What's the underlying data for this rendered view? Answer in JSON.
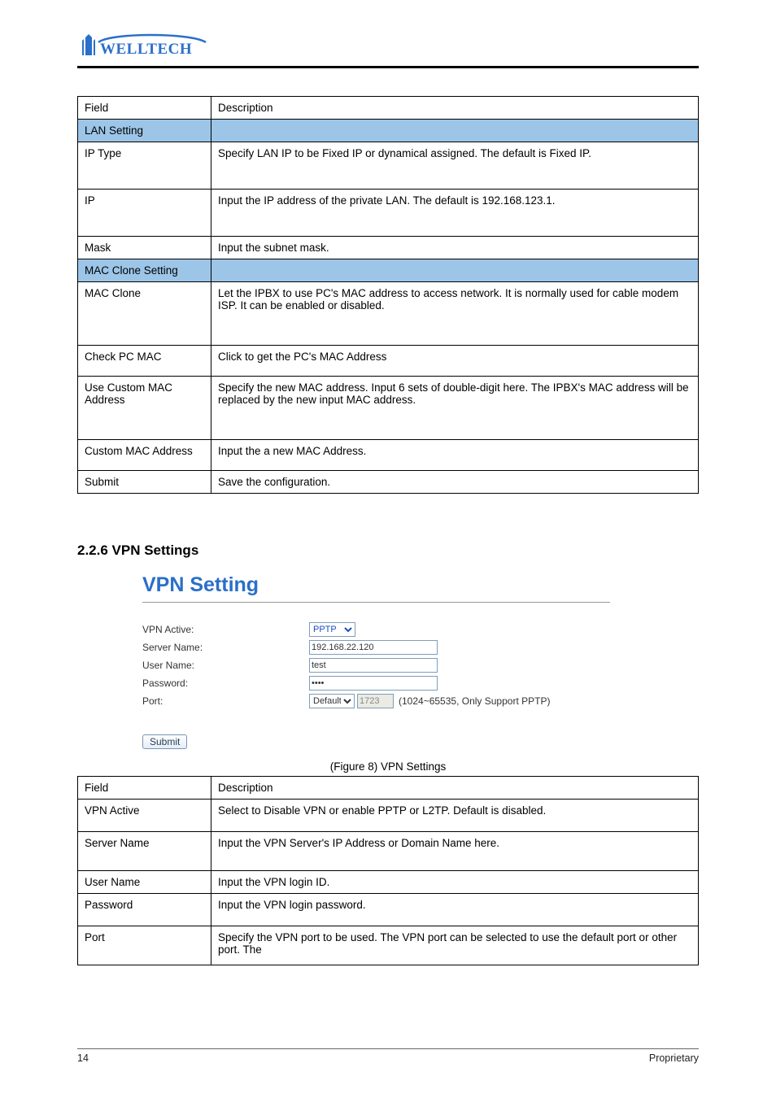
{
  "brand": "WELLTECH",
  "table1": {
    "rows": [
      {
        "c1": "Field",
        "c2": "Description",
        "cls": "h1"
      },
      {
        "c1": "LAN Setting",
        "c2": "",
        "cls": "h1 shade"
      },
      {
        "c1": "IP Type",
        "c2": "Specify LAN IP to be Fixed IP or dynamical assigned.  The default is Fixed IP.",
        "cls": "h3"
      },
      {
        "c1": "IP",
        "c2": "Input the IP address of the private LAN. The default is 192.168.123.1.",
        "cls": "h3"
      },
      {
        "c1": "Mask",
        "c2": "Input the subnet mask.",
        "cls": "h1"
      },
      {
        "c1": "MAC Clone Setting",
        "c2": "",
        "cls": "h1 shade"
      },
      {
        "c1": "MAC Clone",
        "c2": "Let the IPBX to use PC's MAC address to access network. It is normally used for cable modem ISP. It can be enabled or disabled.",
        "cls": "h4"
      },
      {
        "c1": "Check PC MAC",
        "c2": "Click to get the PC's MAC Address",
        "cls": "h2"
      },
      {
        "c1": "Use Custom MAC Address",
        "c2": "Specify the new MAC address. Input 6 sets of double-digit here. The IPBX's MAC address will be replaced by the new input MAC address.",
        "cls": "h4"
      },
      {
        "c1": "Custom MAC Address",
        "c2": "Input the a new MAC Address.",
        "cls": "h2"
      },
      {
        "c1": "Submit",
        "c2": "Save the configuration.",
        "cls": "h1"
      }
    ]
  },
  "section_title": "2.2.6 VPN Settings",
  "vpn": {
    "heading": "VPN Setting",
    "labels": {
      "active": "VPN Active:",
      "server": "Server Name:",
      "user": "User Name:",
      "password": "Password:",
      "port": "Port:"
    },
    "values": {
      "active": "PPTP",
      "server": "192.168.22.120",
      "user": "test",
      "password": "••••",
      "port_mode": "Default",
      "port_val": "1723"
    },
    "port_note": "(1024~65535, Only Support PPTP)",
    "submit": "Submit"
  },
  "figure_caption": "(Figure 8) VPN Settings",
  "table2": {
    "rows": [
      {
        "c1": "Field",
        "c2": "Description",
        "cls": "h1"
      },
      {
        "c1": "VPN Active",
        "c2": "Select to Disable VPN or enable PPTP or L2TP. Default is disabled.",
        "cls": "h2"
      },
      {
        "c1": "Server Name",
        "c2": "Input the VPN Server's IP Address or Domain Name here.",
        "cls": "h3"
      },
      {
        "c1": "User Name",
        "c2": "Input the VPN login ID.",
        "cls": "h1"
      },
      {
        "c1": "Password",
        "c2": "Input the VPN login password.",
        "cls": "h2"
      },
      {
        "c1": "Port",
        "c2": "Specify the VPN port to be used. The VPN port can be selected to use the default port or other port. The",
        "cls": "h3"
      }
    ]
  },
  "footer": {
    "left": "14",
    "right": "Proprietary"
  }
}
